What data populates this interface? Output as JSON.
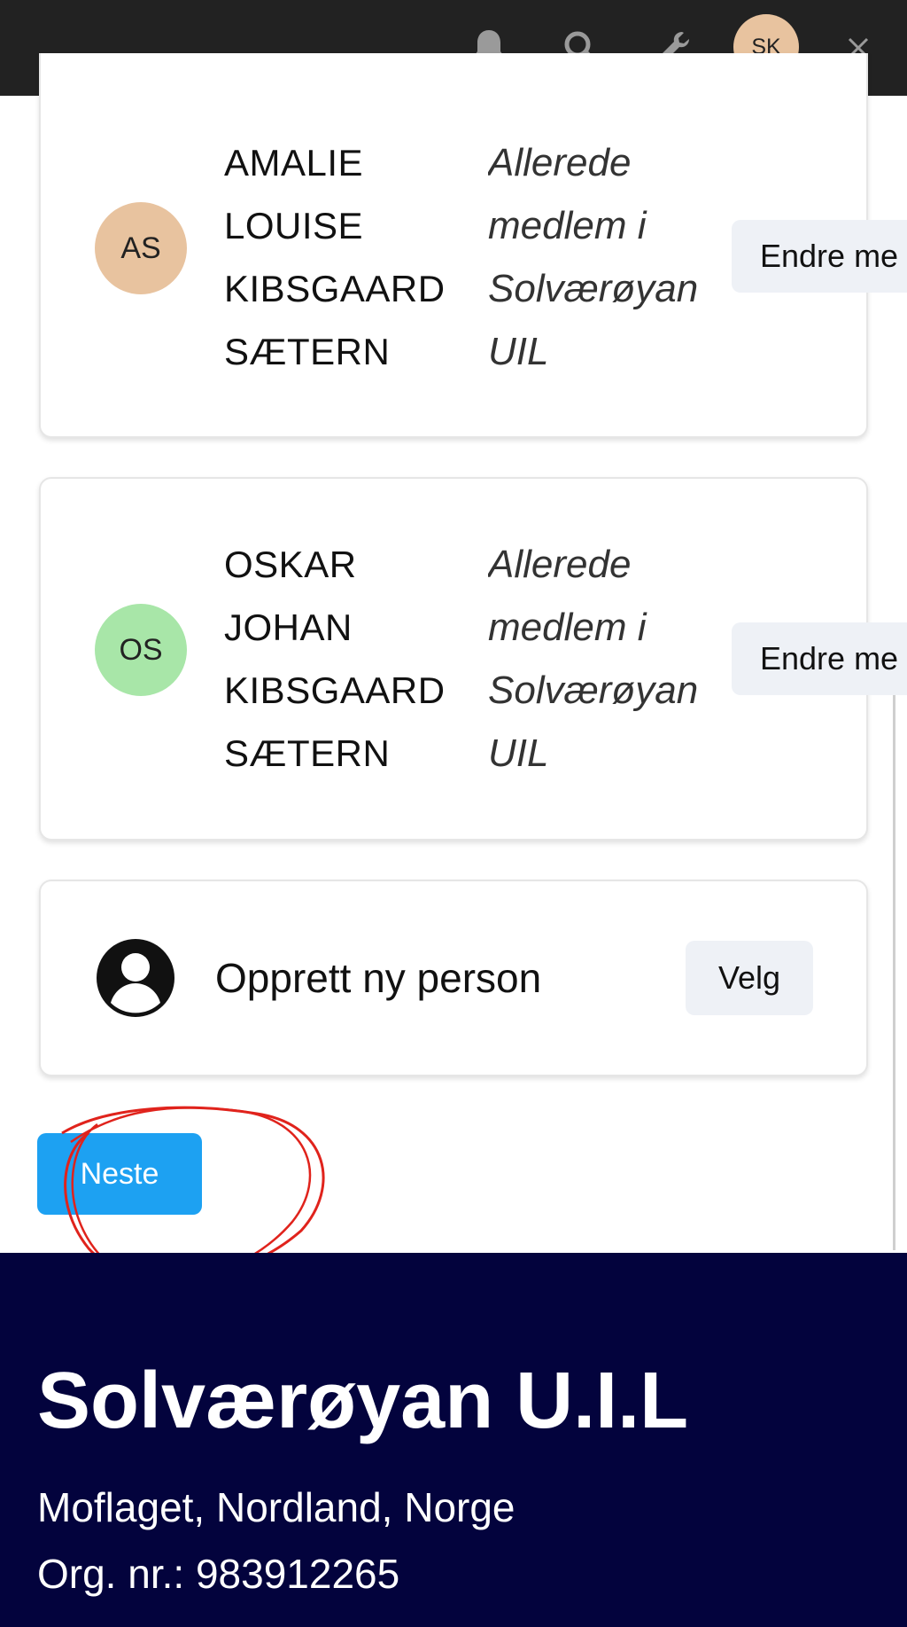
{
  "topbar": {
    "icons": [
      "bell-icon",
      "search-icon",
      "wrench-icon",
      "close-icon"
    ],
    "user_initials": "SK",
    "user_avatar_color": "#e8c39f",
    "background": "#222222"
  },
  "members": [
    {
      "initials": "AS",
      "avatar_color": "#e8c39f",
      "name_lines": [
        "AMALIE",
        "LOUISE",
        "KIBSGAARD",
        "SÆTERN"
      ],
      "status_lines": [
        "Allerede",
        "medlem i",
        "Solværøyan",
        "UIL"
      ],
      "action_label": "Endre me"
    },
    {
      "initials": "OS",
      "avatar_color": "#a8e6a8",
      "name_lines": [
        "OSKAR",
        "JOHAN",
        "KIBSGAARD",
        "SÆTERN"
      ],
      "status_lines": [
        "Allerede",
        "medlem i",
        "Solværøyan",
        "UIL"
      ],
      "action_label": "Endre me"
    }
  ],
  "new_person": {
    "label": "Opprett ny person",
    "button_label": "Velg",
    "icon": "person-circle-icon"
  },
  "next_button": {
    "label": "Neste",
    "color": "#1da1f2"
  },
  "footer": {
    "org_name": "Solværøyan U.I.L",
    "address": "Moflaget, Nordland, Norge",
    "org_number": "Org. nr.: 983912265",
    "background": "#03033d"
  }
}
